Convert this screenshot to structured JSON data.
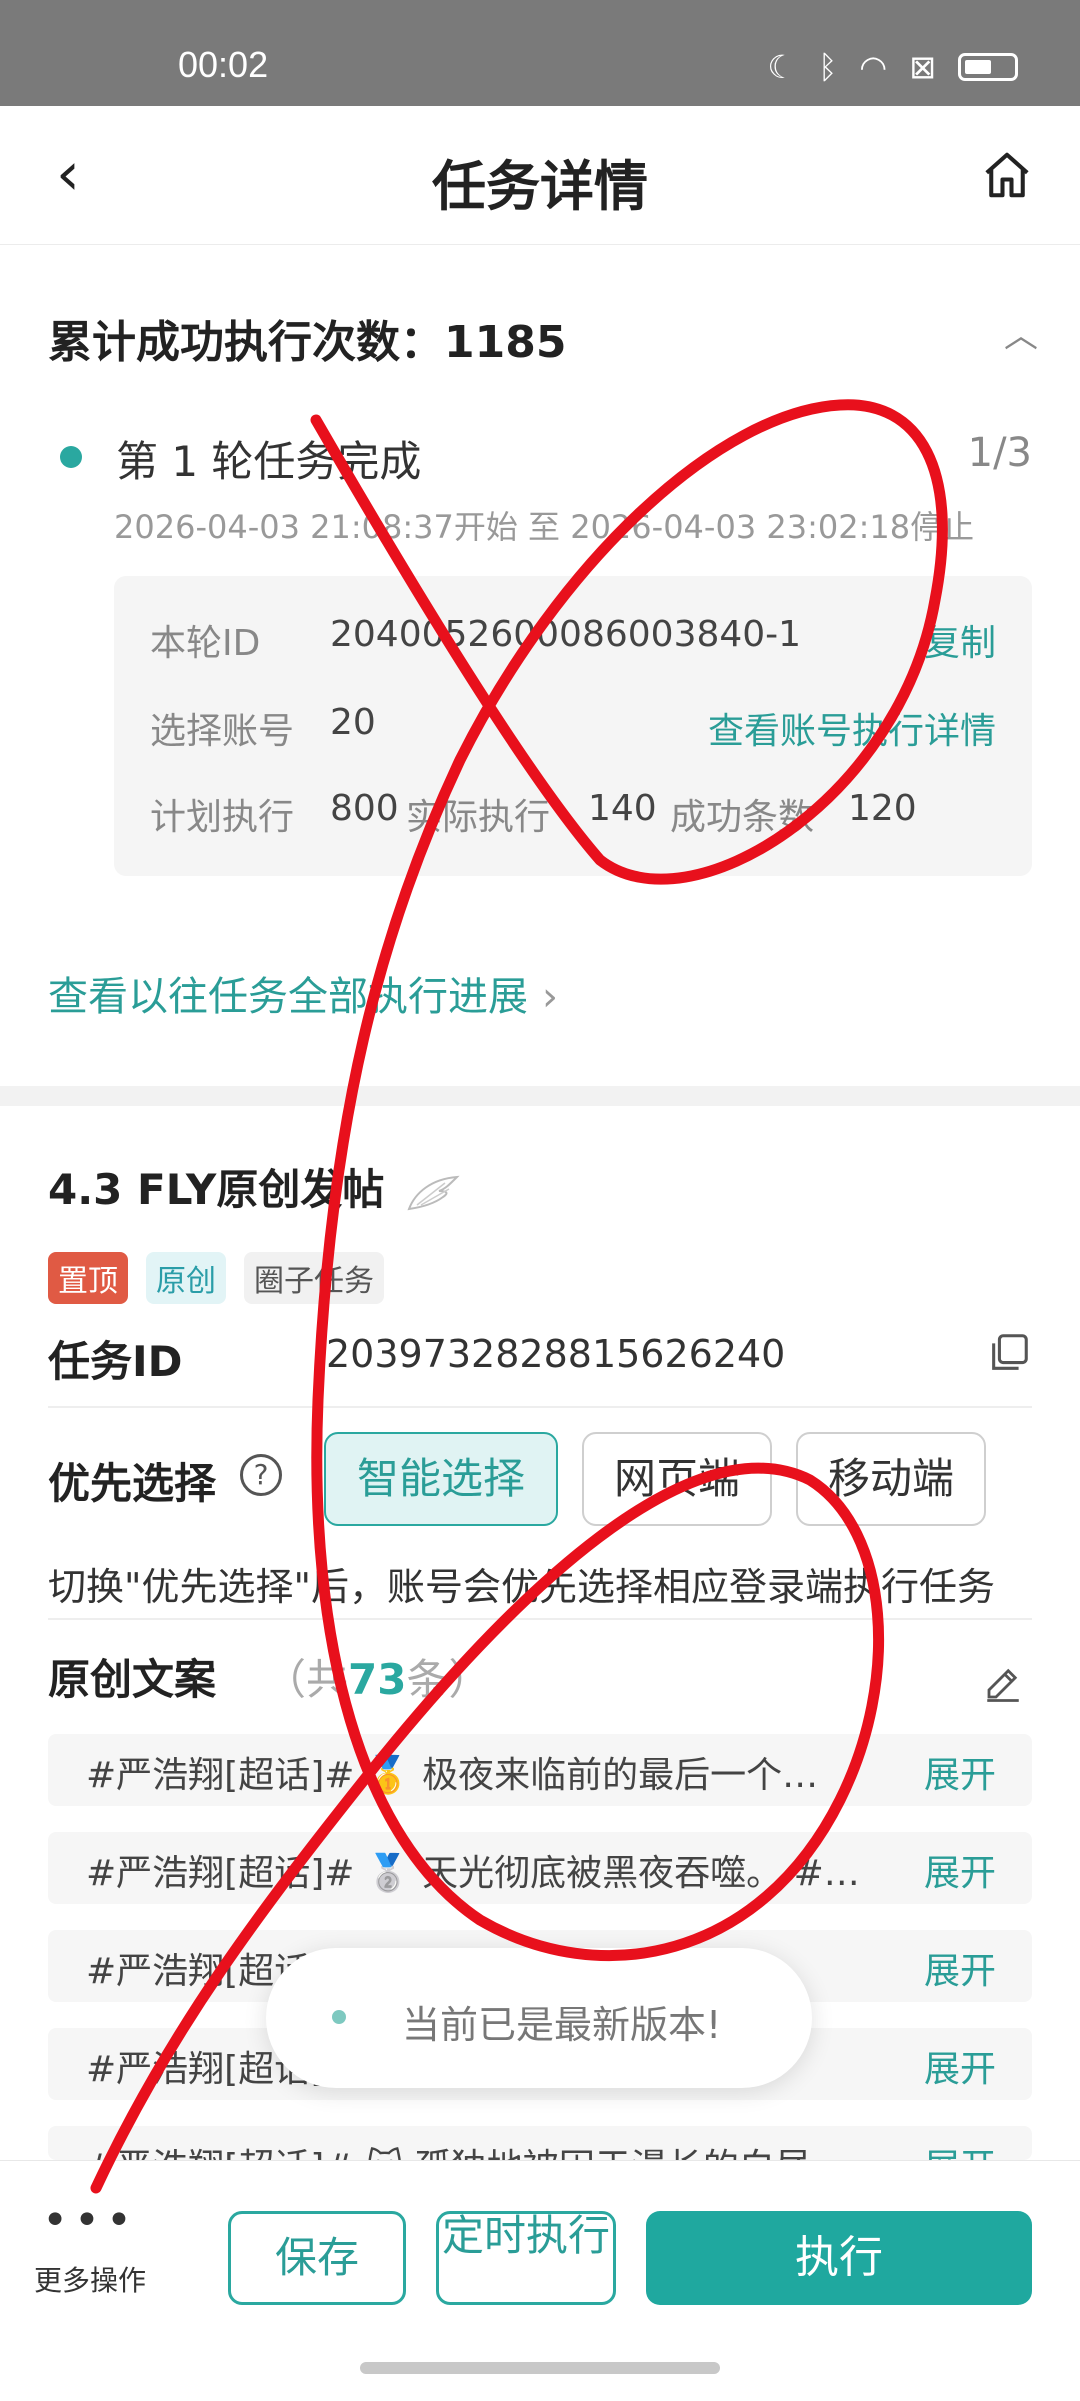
{
  "status_bar": {
    "time": "00:02"
  },
  "nav": {
    "title": "任务详情"
  },
  "summary": {
    "total_label": "累计成功执行次数：",
    "total_value": "1185",
    "round_title": "第 1 轮任务完成",
    "round_count": "1/3",
    "round_time": "2026-04-03 21:08:37开始 至 2026-04-03 23:02:18停止",
    "round_id_label": "本轮ID",
    "round_id_value": "2040052600086003840-1",
    "copy_label": "复制",
    "account_label": "选择账号",
    "account_value": "20",
    "account_link": "查看账号执行详情",
    "plan_label": "计划执行",
    "plan_value": "800",
    "actual_label": "实际执行",
    "actual_value": "140",
    "success_label": "成功条数",
    "success_value": "120",
    "history_link": "查看以往任务全部执行进展"
  },
  "task": {
    "name": "4.3 FLY原创发帖",
    "tags": {
      "top": "置顶",
      "original": "原创",
      "circle": "圈子任务"
    },
    "id_label": "任务ID",
    "id_value": "2039732828815626240",
    "priority_label": "优先选择",
    "priority_options": {
      "smart": "智能选择",
      "web": "网页端",
      "mobile": "移动端"
    },
    "priority_note": "切换\"优先选择\"后，账号会优先选择相应登录端执行任务",
    "copy_title": "原创文案",
    "copy_count_prefix": "（共",
    "copy_count_num": "73",
    "copy_count_suffix": "条）",
    "copy_rows": [
      {
        "text": "#严浩翔[超话]# 🥇 极夜来临前的最后一个…",
        "expand": "展开"
      },
      {
        "text": "#严浩翔[超话]# 🥈 天光彻底被黑夜吞噬。 #…",
        "expand": "展开"
      },
      {
        "text": "#严浩翔[超话]# 🥉 …腾讯…",
        "expand": "展开"
      },
      {
        "text": "#严浩翔[超话]# …的内…",
        "expand": "展开"
      },
      {
        "text": "#严浩翔[超话]# 🐱 孤独地被困于漫长的白昼…",
        "expand": "展开"
      }
    ]
  },
  "toast": {
    "text": "当前已是最新版本!"
  },
  "bottom": {
    "more_label": "更多操作",
    "save_label": "保存",
    "schedule_label": "定时执行",
    "execute_label": "执行"
  },
  "colors": {
    "accent": "#2aa8a0",
    "primary_button": "#1fa89f",
    "tag_top": "#e05a44",
    "scribble": "#e8101c"
  }
}
